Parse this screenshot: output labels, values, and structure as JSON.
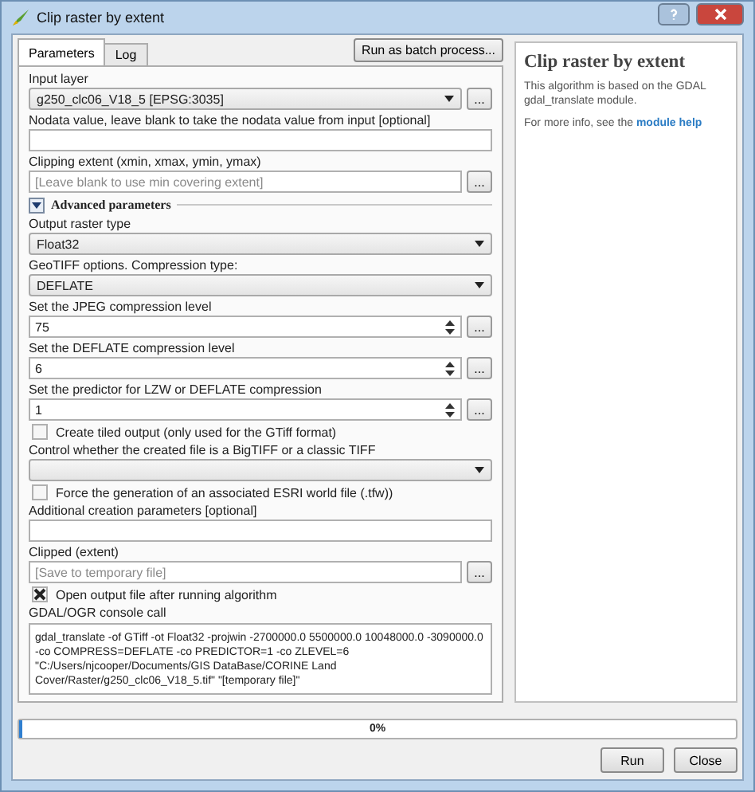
{
  "window": {
    "title": "Clip raster by extent"
  },
  "tabs": [
    {
      "label": "Parameters",
      "selected": true
    },
    {
      "label": "Log",
      "selected": false
    }
  ],
  "batch_button": "Run as batch process...",
  "params": [
    {
      "kind": "combo",
      "label": "Input layer",
      "value": "g250_clc06_V18_5 [EPSG:3035]",
      "browse": "..."
    },
    {
      "kind": "text",
      "label": "Nodata value, leave blank to take the nodata value from input [optional]"
    },
    {
      "kind": "file",
      "label": "Clipping extent (xmin, xmax, ymin, ymax)",
      "placeholder": "[Leave blank to use min covering extent]",
      "browse": "..."
    },
    {
      "kind": "section",
      "label": "Advanced parameters",
      "expanded": true
    },
    {
      "kind": "combo",
      "label": "Output raster type",
      "value": "Float32"
    },
    {
      "kind": "combo",
      "label": "GeoTIFF options. Compression type:",
      "value": "DEFLATE"
    },
    {
      "kind": "spin",
      "label": "Set the JPEG compression level",
      "value": "75",
      "browse": "..."
    },
    {
      "kind": "spin",
      "label": "Set the DEFLATE compression level",
      "value": "6",
      "browse": "..."
    },
    {
      "kind": "spin",
      "label": "Set the predictor for LZW or DEFLATE compression",
      "value": "1",
      "browse": "..."
    },
    {
      "kind": "checkbox",
      "label": "Create tiled output (only used for the GTiff format)",
      "checked": false
    },
    {
      "kind": "combo",
      "label": "Control whether the created file is a BigTIFF or a classic TIFF"
    },
    {
      "kind": "checkbox",
      "label": "Force the generation of an associated ESRI world file (.tfw))",
      "checked": false
    },
    {
      "kind": "text",
      "label": "Additional creation parameters [optional]"
    },
    {
      "kind": "file",
      "label": "Clipped (extent)",
      "placeholder": "[Save to temporary file]",
      "browse": "..."
    },
    {
      "kind": "checkbox",
      "label": "Open output file after running algorithm",
      "checked": true
    },
    {
      "kind": "console",
      "label": "GDAL/OGR console call",
      "value": "gdal_translate -of GTiff -ot Float32 -projwin -2700000.0 5500000.0 10048000.0 -3090000.0 -co COMPRESS=DEFLATE -co PREDICTOR=1 -co ZLEVEL=6 \"C:/Users/njcooper/Documents/GIS DataBase/CORINE Land Cover/Raster/g250_clc06_V18_5.tif\" \"[temporary file]\""
    }
  ],
  "help": {
    "title": "Clip raster by extent",
    "description": "This algorithm is based on the GDAL gdal_translate module.",
    "more": "For more info, see the",
    "link": "module help"
  },
  "progress": {
    "level": 0,
    "text": "0%"
  },
  "buttons": [
    "Run",
    "Close"
  ]
}
